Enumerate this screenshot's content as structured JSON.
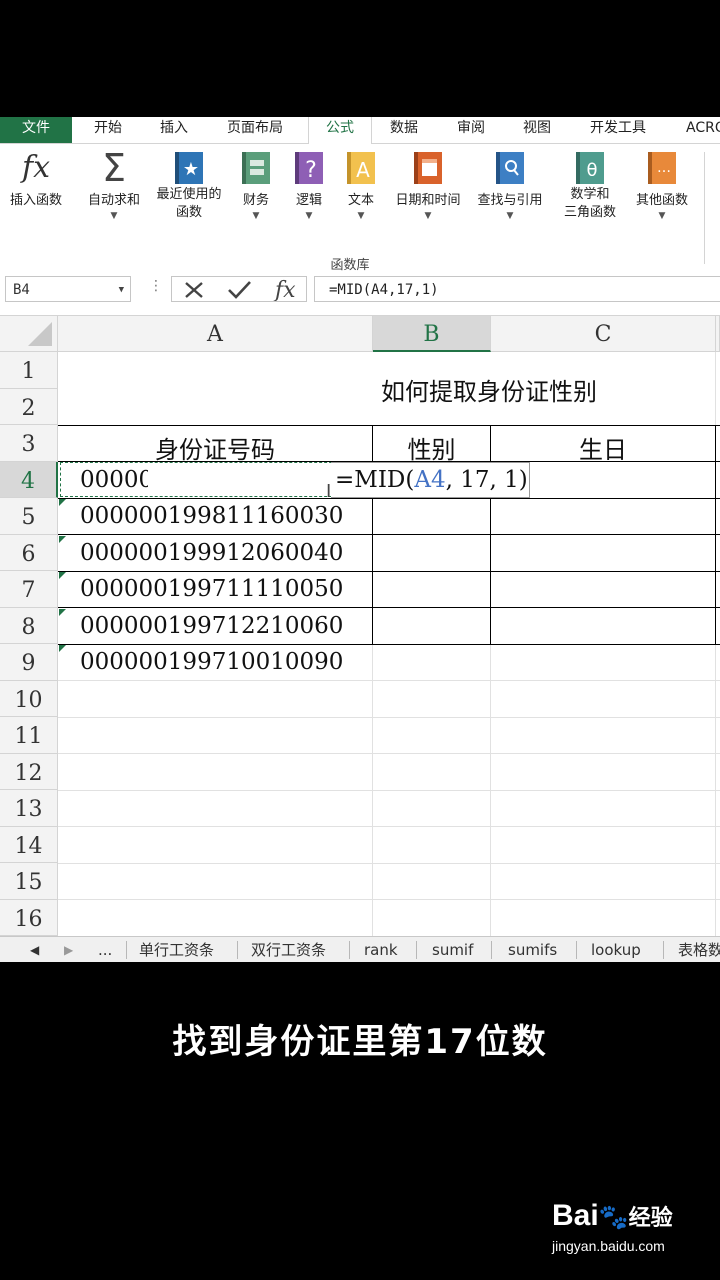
{
  "ribbon_tabs": [
    "文件",
    "开始",
    "插入",
    "页面布局",
    "公式",
    "数据",
    "审阅",
    "视图",
    "开发工具",
    "ACRO"
  ],
  "active_tab": "公式",
  "ribbon_buttons": [
    {
      "label": "插入函数",
      "icon": "fx-icon"
    },
    {
      "label": "自动求和",
      "icon": "sigma-icon"
    },
    {
      "label": "最近使用的",
      "label2": "函数",
      "icon": "star-book-icon"
    },
    {
      "label": "财务",
      "icon": "finance-book-icon"
    },
    {
      "label": "逻辑",
      "icon": "question-book-icon"
    },
    {
      "label": "文本",
      "icon": "text-book-icon"
    },
    {
      "label": "日期和时间",
      "icon": "calendar-book-icon"
    },
    {
      "label": "查找与引用",
      "icon": "search-book-icon"
    },
    {
      "label": "数学和",
      "label2": "三角函数",
      "icon": "theta-book-icon"
    },
    {
      "label": "其他函数",
      "icon": "more-book-icon"
    }
  ],
  "ribbon_group_label": "函数库",
  "name_box": "B4",
  "formula_bar": "=MID(A4,17,1)",
  "columns": [
    "A",
    "B",
    "C"
  ],
  "rows": [
    "1",
    "2",
    "3",
    "4",
    "5",
    "6",
    "7",
    "8",
    "9",
    "10",
    "11",
    "12",
    "13",
    "14",
    "15",
    "16"
  ],
  "title_cell": "如何提取身份证性别",
  "headers": {
    "a": "身份证号码",
    "b": "性别",
    "c": "生日"
  },
  "id_numbers": [
    "00000",
    "000000199811160030",
    "000000199912060040",
    "000000199711110050",
    "000000199712210060",
    "000000199710010090"
  ],
  "editing_formula": {
    "prefix": "=MID(",
    "ref": "A4",
    "suffix": ", 17, 1)"
  },
  "sheet_tabs": [
    "...",
    "单行工资条",
    "双行工资条",
    "rank",
    "sumif",
    "sumifs",
    "lookup",
    "表格数"
  ],
  "caption": "找到身份证里第17位数",
  "watermark": {
    "brand": "Bai",
    "brand2": "经验",
    "url": "jingyan.baidu.com"
  },
  "colors": {
    "excel_green": "#217346",
    "ref_blue": "#4472c4"
  }
}
